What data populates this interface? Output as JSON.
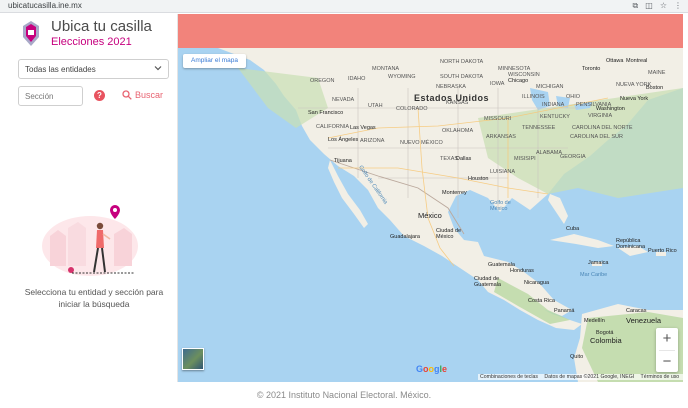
{
  "browser": {
    "url": "ubicatucasilla.ine.mx"
  },
  "header": {
    "title": "Ubica tu casilla",
    "subtitle": "Elecciones 2021"
  },
  "filters": {
    "entity_select": "Todas las entidades",
    "section_placeholder": "Sección",
    "search_label": "Buscar"
  },
  "empty_state": {
    "message": "Selecciona tu entidad y sección para iniciar la búsqueda"
  },
  "map": {
    "expand_button": "Ampliar el mapa",
    "google": "Google",
    "attribution": [
      "Combinaciones de teclas",
      "Datos de mapas ©2021 Google, INEGI",
      "Términos de uso"
    ],
    "zoom_in": "+",
    "zoom_out": "−",
    "country_labels": [
      "Estados Unidos",
      "México",
      "Venezuela",
      "Colombia"
    ],
    "labels": [
      "MONTANA",
      "NORTH DAKOTA",
      "MINNESOTA",
      "SOUTH DAKOTA",
      "WYOMING",
      "IDAHO",
      "OREGON",
      "NEVADA",
      "UTAH",
      "COLORADO",
      "NEBRASKA",
      "KANSAS",
      "IOWA",
      "MISSOURI",
      "ILLINOIS",
      "OKLAHOMA",
      "ARKANSAS",
      "ARIZONA",
      "NUEVO MÉXICO",
      "TEXAS",
      "MISISIPI",
      "ALABAMA",
      "GEORGIA",
      "TENNESSEE",
      "KENTUCKY",
      "OHIO",
      "INDIANA",
      "VIRGINIA",
      "CAROLINA DEL NORTE",
      "CAROLINA DEL SUR",
      "LUISIANA",
      "CALIFORNIA",
      "NUEVA YORK",
      "PENSILVANIA",
      "MICHIGAN",
      "WISCONSIN",
      "MAINE"
    ],
    "cities": [
      "Chicago",
      "Toronto",
      "Ottawa",
      "Montreal",
      "Boston",
      "Nueva York",
      "Washington",
      "San Francisco",
      "Las Vegas",
      "Los Ángeles",
      "Tijuana",
      "Dallas",
      "Houston",
      "Monterrey",
      "Guadalajara",
      "Ciudad de México",
      "Cuba",
      "Guatemala",
      "Honduras",
      "Nicaragua",
      "Costa Rica",
      "Panamá",
      "Medellín",
      "Bogotá",
      "Caracas",
      "Quito",
      "Puerto Rico",
      "República Dominicana",
      "Ciudad de Guatemala",
      "Jamaica"
    ],
    "seas": [
      "Golfo de México",
      "Mar Caribe",
      "Golfo de California"
    ]
  },
  "footer": "© 2021 Instituto Nacional Electoral. México.",
  "colors": {
    "accent": "#c6007e",
    "banner": "#f2837b",
    "search": "#e86472",
    "water": "#a9d3f1",
    "land": "#f2efe6",
    "green": "#c9dfb4"
  }
}
